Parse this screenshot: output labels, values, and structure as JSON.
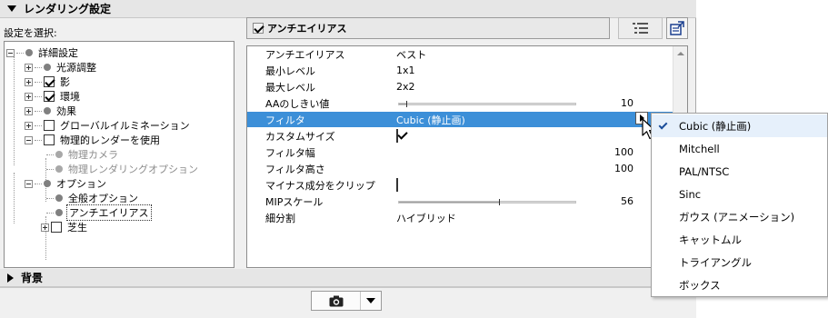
{
  "header": {
    "title": "レンダリング設定"
  },
  "tree": {
    "select_label": "設定を選択:",
    "nodes": [
      {
        "label": "詳細設定"
      },
      {
        "label": "光源調整"
      },
      {
        "label": "影"
      },
      {
        "label": "環境"
      },
      {
        "label": "効果"
      },
      {
        "label": "グローバルイルミネーション"
      },
      {
        "label": "物理的レンダーを使用"
      },
      {
        "label": "物理カメラ"
      },
      {
        "label": "物理レンダリングオプション"
      },
      {
        "label": "オプション"
      },
      {
        "label": "全般オプション"
      },
      {
        "label": "アンチエイリアス"
      },
      {
        "label": "芝生"
      }
    ]
  },
  "right_header": {
    "title": "アンチエイリアス"
  },
  "properties": [
    {
      "key": "アンチエイリアス",
      "value": "ベスト"
    },
    {
      "key": "最小レベル",
      "value": "1x1"
    },
    {
      "key": "最大レベル",
      "value": "2x2"
    },
    {
      "key": "AAのしきい値",
      "value": "10",
      "slider_level": 0.04
    },
    {
      "key": "フィルタ",
      "value": "Cubic (静止画)"
    },
    {
      "key": "カスタムサイズ",
      "value": ""
    },
    {
      "key": "フィルタ幅",
      "value": "100"
    },
    {
      "key": "フィルタ高さ",
      "value": "100"
    },
    {
      "key": "マイナス成分をクリップ",
      "value": ""
    },
    {
      "key": "MIPスケール",
      "value": "56",
      "slider_level": 0.56
    },
    {
      "key": "細分割",
      "value": "ハイブリッド"
    }
  ],
  "menu": {
    "items": [
      {
        "label": "Cubic (静止画)",
        "checked": true
      },
      {
        "label": "Mitchell"
      },
      {
        "label": "PAL/NTSC"
      },
      {
        "label": "Sinc"
      },
      {
        "label": "ガウス (アニメーション)"
      },
      {
        "label": "キャットムル"
      },
      {
        "label": "トライアングル"
      },
      {
        "label": "ボックス"
      }
    ]
  },
  "footer_section": {
    "title": "背景"
  },
  "icons": {
    "collapse": "triangle-down-icon",
    "expand": "triangle-right-icon",
    "list": "list-view-icon",
    "export": "export-icon",
    "camera": "camera-icon",
    "dropdown": "chevron-down-icon"
  },
  "colors": {
    "selection": "#3c8fd8",
    "checkmark": "#1a4d9a"
  }
}
